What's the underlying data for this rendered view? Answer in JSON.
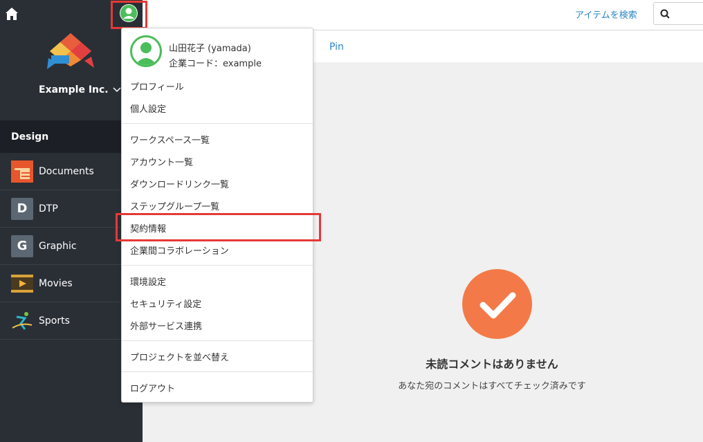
{
  "topbar": {
    "search_link": "アイテムを検索",
    "search_placeholder": ""
  },
  "sidebar": {
    "company": "Example Inc.",
    "section": "Design",
    "items": [
      {
        "label": "Documents",
        "icon": "documents-icon"
      },
      {
        "label": "DTP",
        "letter": "D"
      },
      {
        "label": "Graphic",
        "letter": "G"
      },
      {
        "label": "Movies",
        "icon": "movies-icon"
      },
      {
        "label": "Sports",
        "icon": "sports-icon"
      }
    ]
  },
  "content": {
    "tab": "Pin",
    "empty_title": "未読コメントはありません",
    "empty_subtitle": "あなた宛のコメントはすべてチェック済みです"
  },
  "dropdown": {
    "user_name": "山田花子 (yamada)",
    "company_code": "企業コード：example",
    "groups": [
      [
        "プロフィール",
        "個人設定"
      ],
      [
        "ワークスペース一覧",
        "アカウント一覧",
        "ダウンロードリンク一覧",
        "ステップグループ一覧",
        "契約情報",
        "企業間コラボレーション"
      ],
      [
        "環境設定",
        "セキュリティ設定",
        "外部サービス連携"
      ],
      [
        "プロジェクトを並べ替え"
      ],
      [
        "ログアウト"
      ]
    ]
  },
  "colors": {
    "sidebar_bg": "#2a2f36",
    "accent_link": "#2a86c6",
    "avatar_green": "#4cbd5b",
    "check_orange": "#f37a48",
    "highlight_red": "#e53935"
  }
}
